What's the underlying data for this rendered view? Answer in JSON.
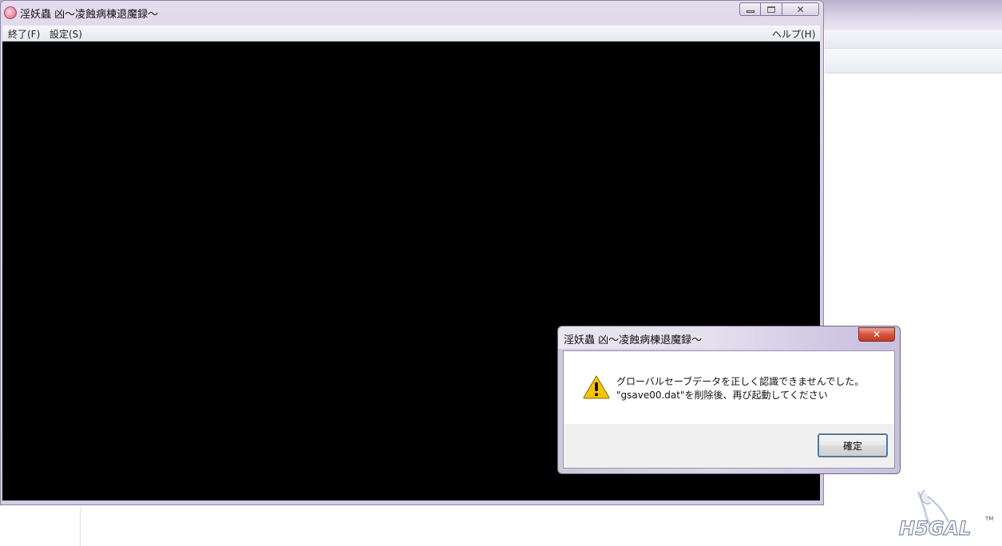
{
  "main_window": {
    "title": "淫妖蟲 凶～凌蝕病棟退魔録～",
    "menu": {
      "exit": "終了(F)",
      "settings": "設定(S)",
      "help": "ヘルプ(H)"
    }
  },
  "dialog": {
    "title": "淫妖蟲 凶～凌蝕病棟退魔録～",
    "close_symbol": "✕",
    "message_line1": "グローバルセーブデータを正しく認識できませんでした。",
    "message_line2": "\"gsave00.dat\"を削除後、再び起動してください",
    "ok_label": "確定",
    "icon": "warning-icon"
  },
  "watermark": {
    "text": "H5GAL",
    "tm": "TM"
  },
  "colors": {
    "title_bar": "#d8d0e8",
    "game_area": "#000000",
    "dialog_close": "#c43a22",
    "warning": "#f5c400"
  }
}
